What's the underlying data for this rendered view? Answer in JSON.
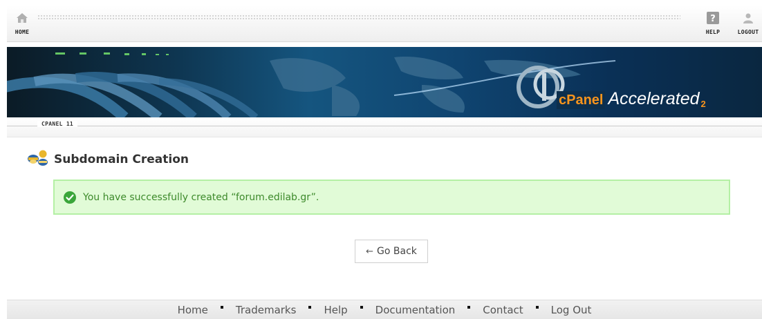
{
  "topbar": {
    "home_label": "HOME",
    "help_label": "HELP",
    "logout_label": "LOGOUT",
    "home_icon": "home-icon",
    "help_icon": "help-icon",
    "logout_icon": "user-icon"
  },
  "banner": {
    "brand_cpanel": "cPanel",
    "brand_accelerated": "Accelerated",
    "brand_version": "2"
  },
  "section": {
    "label": "CPANEL 11"
  },
  "main": {
    "title": "Subdomain Creation",
    "title_icon": "subdomain-icon",
    "success_message": "You have successfully created “forum.edilab.gr”.",
    "success_icon": "checkmark-icon",
    "go_back_label": "Go Back",
    "go_back_arrow": "←"
  },
  "footer": {
    "links": [
      "Home",
      "Trademarks",
      "Help",
      "Documentation",
      "Contact",
      "Log Out"
    ]
  },
  "colors": {
    "success_bg": "#e1fbd7",
    "success_border": "#b4f0a4",
    "success_text": "#3d8a2b",
    "brand_orange": "#f7941d"
  }
}
